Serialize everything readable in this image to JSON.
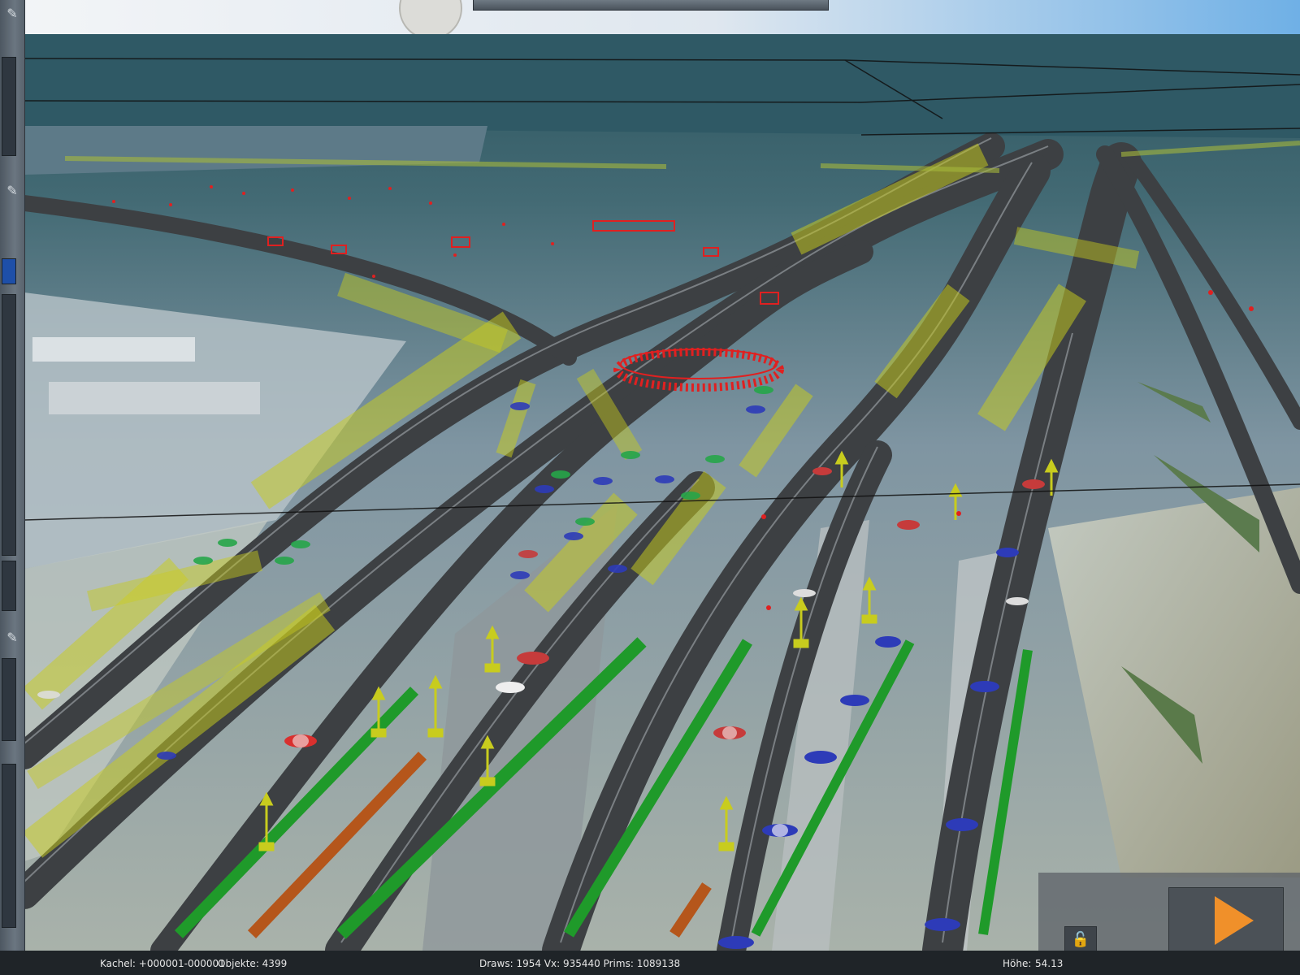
{
  "status": {
    "tile": "Kachel: +000001-000001",
    "objects": "Objekte: 4399",
    "render": "Draws: 1954 Vx: 935440 Prims: 1089138",
    "height_label": "Höhe:",
    "height_value": "54.13"
  },
  "toolbar": {
    "pin_icon": "pin-icon",
    "lock_icon": "unlock-icon",
    "play_icon": "play-icon"
  },
  "colors": {
    "accent": "#f0902a",
    "marker": "#c8cc1e",
    "track_highlight": "#1f9a2a",
    "track_orange": "#b5561b",
    "signal_red": "#e02020"
  }
}
